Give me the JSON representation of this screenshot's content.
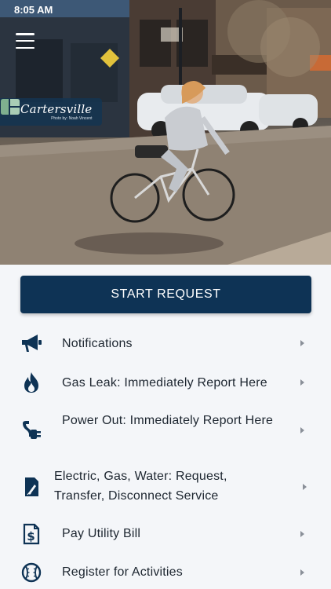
{
  "status_bar": {
    "time": "8:05 AM"
  },
  "hero": {
    "logo_name": "Cartersville",
    "photo_credit": "Photo by: Noah Vincent"
  },
  "start_request": {
    "label": "START REQUEST"
  },
  "menu": [
    {
      "label": "Notifications",
      "icon": "megaphone-icon"
    },
    {
      "label": "Gas Leak: Immediately Report Here",
      "icon": "flame-icon"
    },
    {
      "label": "Power Out: Immediately Report Here",
      "icon": "plug-icon"
    },
    {
      "label": "Electric, Gas, Water: Request, Transfer, Disconnect Service",
      "icon": "document-sign-icon"
    },
    {
      "label": "Pay Utility Bill",
      "icon": "bill-dollar-icon"
    },
    {
      "label": "Register for Activities",
      "icon": "baseball-icon"
    }
  ],
  "colors": {
    "primary": "#0e3355",
    "icon": "#0e3355",
    "background": "#f4f6f9",
    "text": "#1d2630"
  }
}
